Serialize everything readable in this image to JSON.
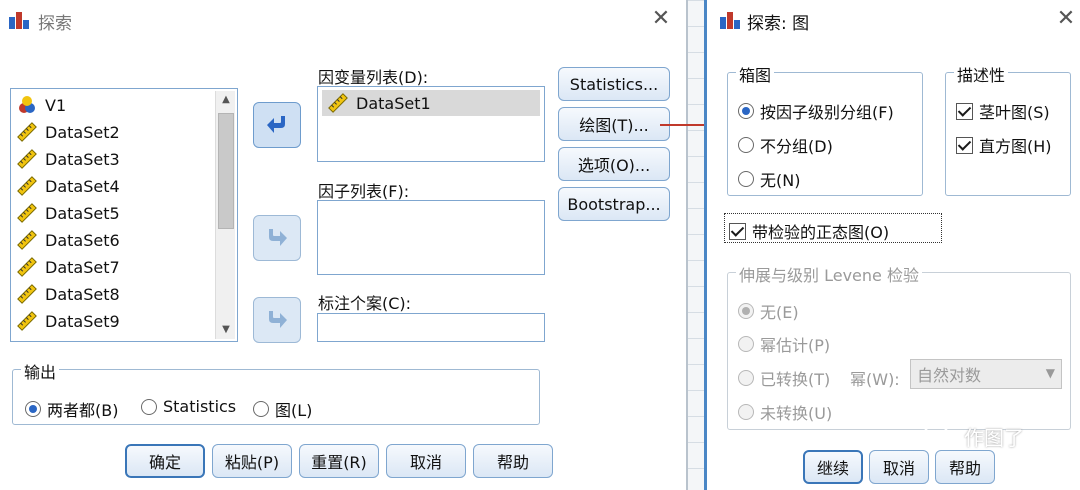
{
  "explore_window": {
    "title": "探索",
    "variables": [
      "V1",
      "DataSet2",
      "DataSet3",
      "DataSet4",
      "DataSet5",
      "DataSet6",
      "DataSet7",
      "DataSet8",
      "DataSet9"
    ],
    "dependent_label": "因变量列表(D):",
    "dependent_items": [
      "DataSet1"
    ],
    "factor_label": "因子列表(F):",
    "label_cases_label": "标注个案(C):",
    "side_buttons": {
      "statistics": "Statistics...",
      "plots": "绘图(T)...",
      "options": "选项(O)...",
      "bootstrap": "Bootstrap..."
    },
    "output": {
      "title": "输出",
      "options": [
        "两者都(B)",
        "Statistics",
        "图(L)"
      ],
      "selected": "两者都(B)"
    },
    "footer_buttons": {
      "ok": "确定",
      "paste": "粘贴(P)",
      "reset": "重置(R)",
      "cancel": "取消",
      "help": "帮助"
    }
  },
  "plots_window": {
    "title": "探索: 图",
    "boxplots": {
      "title": "箱图",
      "options": [
        "按因子级别分组(F)",
        "不分组(D)",
        "无(N)"
      ],
      "selected": "按因子级别分组(F)"
    },
    "descriptive": {
      "title": "描述性",
      "stem_and_leaf": "茎叶图(S)",
      "histogram": "直方图(H)",
      "stem_checked": true,
      "hist_checked": true
    },
    "normality": {
      "label": "带检验的正态图(O)",
      "checked": true
    },
    "levene": {
      "title": "伸展与级别 Levene 检验",
      "none": "无(E)",
      "power_estimation": "幂估计(P)",
      "transformed": "已转换(T)",
      "power_label": "幂(W):",
      "power_value": "自然对数",
      "untransformed": "未转换(U)",
      "selected": "无(E)"
    },
    "footer_buttons": {
      "continue": "继续",
      "cancel": "取消",
      "help": "帮助"
    }
  },
  "watermark": {
    "text": "作图了"
  },
  "colors": {
    "accent": "#2a66c4",
    "arrow": "#c0392b",
    "border": "#7fa6cf"
  }
}
